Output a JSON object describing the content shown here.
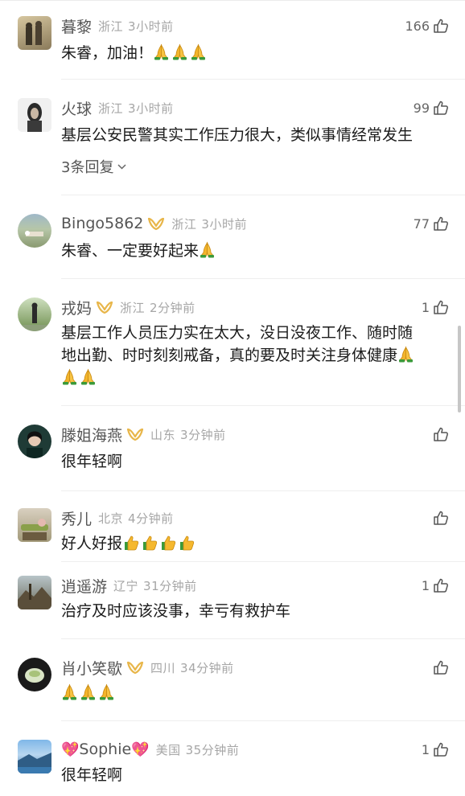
{
  "comments": [
    {
      "name": "暮黎",
      "vip": false,
      "region": "浙江",
      "time": "3小时前",
      "likes": "166",
      "text": "朱睿，加油！",
      "emoji": [
        "pray",
        "pray",
        "pray"
      ],
      "replies": ""
    },
    {
      "name": "火球",
      "vip": false,
      "region": "浙江",
      "time": "3小时前",
      "likes": "99",
      "text": "基层公安民警其实工作压力很大，类似事情经常发生",
      "emoji": [],
      "replies": "3条回复"
    },
    {
      "name": "Bingo5862",
      "vip": true,
      "region": "浙江",
      "time": "3小时前",
      "likes": "77",
      "text": "朱睿、一定要好起来",
      "emoji": [
        "pray"
      ],
      "replies": ""
    },
    {
      "name": "戎妈",
      "vip": true,
      "region": "浙江",
      "time": "2分钟前",
      "likes": "1",
      "text_line1": "基层工作人员压力实在太大，没日没夜工作、随时随",
      "text_line2": "地出勤、时时刻刻戒备，真的要及时关注身体健康",
      "emoji": [
        "pray",
        "pray",
        "pray"
      ],
      "replies": ""
    },
    {
      "name": "滕姐海燕",
      "vip": true,
      "region": "山东",
      "time": "3分钟前",
      "likes": "",
      "text": "很年轻啊",
      "emoji": [],
      "replies": ""
    },
    {
      "name": "秀儿",
      "vip": false,
      "region": "北京",
      "time": "4分钟前",
      "likes": "",
      "text": "好人好报",
      "emoji": [
        "thumb",
        "thumb",
        "thumb",
        "thumb"
      ],
      "replies": ""
    },
    {
      "name": "逍遥游",
      "vip": false,
      "region": "辽宁",
      "time": "31分钟前",
      "likes": "1",
      "text": "治疗及时应该没事，幸亏有救护车",
      "emoji": [],
      "replies": ""
    },
    {
      "name": "肖小笑歇",
      "vip": true,
      "region": "四川",
      "time": "34分钟前",
      "likes": "",
      "text": "",
      "emoji": [
        "pray",
        "pray",
        "pray"
      ],
      "replies": ""
    },
    {
      "name": "Sophie",
      "vip": false,
      "region": "美国",
      "time": "35分钟前",
      "likes": "1",
      "text": "很年轻啊",
      "emoji": [],
      "replies": ""
    }
  ],
  "colors": {
    "name": "#555555",
    "meta": "#a6a6a6",
    "vip": "#e8b64a",
    "emoji": "#f5b82e"
  }
}
